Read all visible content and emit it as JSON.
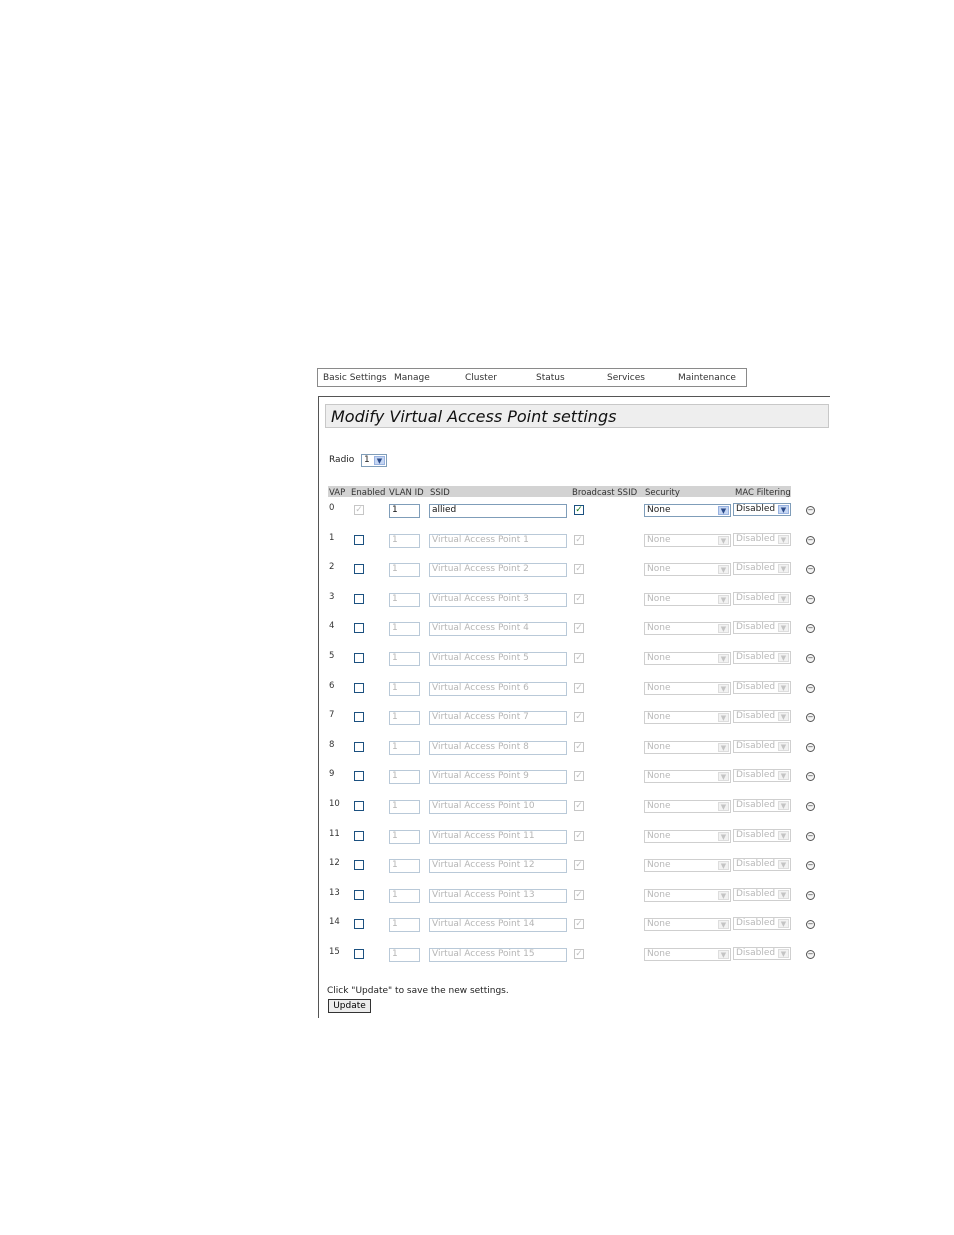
{
  "nav": [
    {
      "label": "Basic Settings"
    },
    {
      "label": "Manage"
    },
    {
      "label": "Cluster"
    },
    {
      "label": "Status"
    },
    {
      "label": "Services"
    },
    {
      "label": "Maintenance"
    }
  ],
  "title": "Modify Virtual Access Point settings",
  "radio": {
    "label": "Radio",
    "value": "1"
  },
  "columns": {
    "vap": "VAP",
    "enabled": "Enabled",
    "vlan": "VLAN ID",
    "ssid": "SSID",
    "broadcast": "Broadcast SSID",
    "security": "Security",
    "mac": "MAC Filtering"
  },
  "rows": [
    {
      "vap": "0",
      "enabled": true,
      "vlan": "1",
      "ssid": "allied",
      "broadcast": true,
      "security": "None",
      "mac": "Disabled",
      "active": true
    },
    {
      "vap": "1",
      "enabled": false,
      "vlan": "1",
      "ssid": "Virtual Access Point 1",
      "broadcast": true,
      "security": "None",
      "mac": "Disabled",
      "active": false
    },
    {
      "vap": "2",
      "enabled": false,
      "vlan": "1",
      "ssid": "Virtual Access Point 2",
      "broadcast": true,
      "security": "None",
      "mac": "Disabled",
      "active": false
    },
    {
      "vap": "3",
      "enabled": false,
      "vlan": "1",
      "ssid": "Virtual Access Point 3",
      "broadcast": true,
      "security": "None",
      "mac": "Disabled",
      "active": false
    },
    {
      "vap": "4",
      "enabled": false,
      "vlan": "1",
      "ssid": "Virtual Access Point 4",
      "broadcast": true,
      "security": "None",
      "mac": "Disabled",
      "active": false
    },
    {
      "vap": "5",
      "enabled": false,
      "vlan": "1",
      "ssid": "Virtual Access Point 5",
      "broadcast": true,
      "security": "None",
      "mac": "Disabled",
      "active": false
    },
    {
      "vap": "6",
      "enabled": false,
      "vlan": "1",
      "ssid": "Virtual Access Point 6",
      "broadcast": true,
      "security": "None",
      "mac": "Disabled",
      "active": false
    },
    {
      "vap": "7",
      "enabled": false,
      "vlan": "1",
      "ssid": "Virtual Access Point 7",
      "broadcast": true,
      "security": "None",
      "mac": "Disabled",
      "active": false
    },
    {
      "vap": "8",
      "enabled": false,
      "vlan": "1",
      "ssid": "Virtual Access Point 8",
      "broadcast": true,
      "security": "None",
      "mac": "Disabled",
      "active": false
    },
    {
      "vap": "9",
      "enabled": false,
      "vlan": "1",
      "ssid": "Virtual Access Point 9",
      "broadcast": true,
      "security": "None",
      "mac": "Disabled",
      "active": false
    },
    {
      "vap": "10",
      "enabled": false,
      "vlan": "1",
      "ssid": "Virtual Access Point 10",
      "broadcast": true,
      "security": "None",
      "mac": "Disabled",
      "active": false
    },
    {
      "vap": "11",
      "enabled": false,
      "vlan": "1",
      "ssid": "Virtual Access Point 11",
      "broadcast": true,
      "security": "None",
      "mac": "Disabled",
      "active": false
    },
    {
      "vap": "12",
      "enabled": false,
      "vlan": "1",
      "ssid": "Virtual Access Point 12",
      "broadcast": true,
      "security": "None",
      "mac": "Disabled",
      "active": false
    },
    {
      "vap": "13",
      "enabled": false,
      "vlan": "1",
      "ssid": "Virtual Access Point 13",
      "broadcast": true,
      "security": "None",
      "mac": "Disabled",
      "active": false
    },
    {
      "vap": "14",
      "enabled": false,
      "vlan": "1",
      "ssid": "Virtual Access Point 14",
      "broadcast": true,
      "security": "None",
      "mac": "Disabled",
      "active": false
    },
    {
      "vap": "15",
      "enabled": false,
      "vlan": "1",
      "ssid": "Virtual Access Point 15",
      "broadcast": true,
      "security": "None",
      "mac": "Disabled",
      "active": false
    }
  ],
  "footer": {
    "note": "Click \"Update\" to save the new settings.",
    "update_label": "Update"
  },
  "colors": {
    "accent_border": "#7f9db9",
    "check_green": "#1a7a1a",
    "header_bar": "#d3d3d3",
    "title_bar": "#eeeeee"
  },
  "icons": {
    "row_action": "circle-minus-icon",
    "dropdown": "chevron-down-icon",
    "check": "checkmark-icon"
  }
}
